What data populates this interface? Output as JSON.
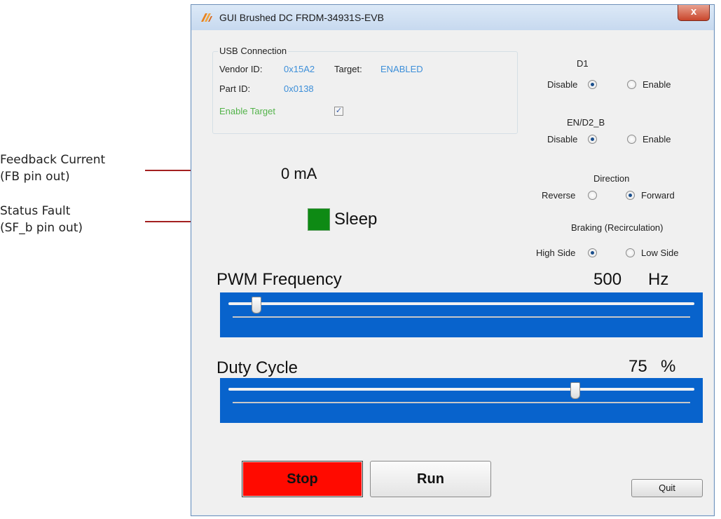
{
  "callouts": {
    "feedback": {
      "line1": "Feedback Current",
      "line2": "(FB pin out)"
    },
    "fault": {
      "line1": "Status Fault",
      "line2": "(SF_b pin out)"
    }
  },
  "window": {
    "title": "GUI Brushed DC FRDM-34931S-EVB",
    "close_label": "x"
  },
  "usb": {
    "legend": "USB Connection",
    "vendor_label": "Vendor ID:",
    "vendor_value": "0x15A2",
    "target_label": "Target:",
    "target_value": "ENABLED",
    "part_label": "Part ID:",
    "part_value": "0x0138",
    "enable_target_label": "Enable Target",
    "enable_target_checked": true,
    "check_glyph": "✓"
  },
  "controls": {
    "d1": {
      "label": "D1",
      "left": "Disable",
      "right": "Enable",
      "selected": "Disable"
    },
    "en_d2b": {
      "label": "EN/D2_B",
      "left": "Disable",
      "right": "Enable",
      "selected": "Disable"
    },
    "direction": {
      "label": "Direction",
      "left": "Reverse",
      "right": "Forward",
      "selected": "Forward"
    },
    "braking": {
      "label": "Braking (Recirculation)",
      "left": "High Side",
      "right": "Low Side",
      "selected": "High Side"
    }
  },
  "feedback": {
    "value": "0 mA"
  },
  "status": {
    "text": "Sleep",
    "color": "#0e8a14"
  },
  "pwm": {
    "label": "PWM Frequency",
    "value": "500",
    "unit": "Hz",
    "slider_fraction": 0.05
  },
  "duty": {
    "label": "Duty Cycle",
    "value": "75",
    "unit": "%",
    "slider_fraction": 0.75
  },
  "buttons": {
    "stop": "Stop",
    "run": "Run",
    "quit": "Quit"
  },
  "colors": {
    "accent_blue": "#0863cc",
    "stop_red": "#ff0a00",
    "arrow": "#a32020"
  }
}
